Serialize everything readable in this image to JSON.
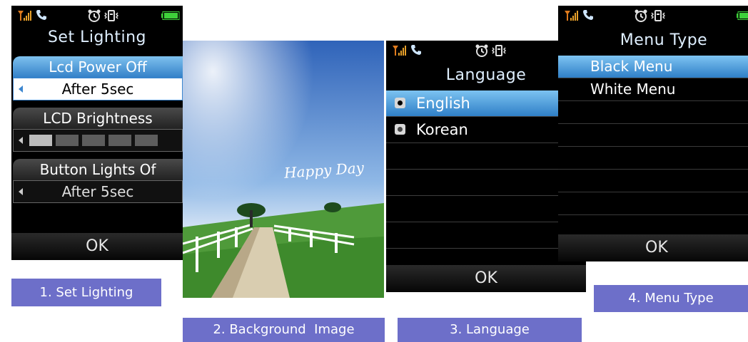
{
  "colors": {
    "caption_bg": "#6d6fc9",
    "highlight_blue": "#3380c8",
    "screen_bg": "#000000"
  },
  "screen1": {
    "title": "Set Lighting",
    "sections": [
      {
        "label": "Lcd Power Off",
        "value": "After 5sec"
      },
      {
        "label": "LCD Brightness",
        "level_filled": 1,
        "level_total": 5
      },
      {
        "label": "Button Lights Of",
        "value": "After 5sec"
      }
    ],
    "ok": "OK"
  },
  "screen2": {
    "overlay_text": "Happy Day"
  },
  "screen3": {
    "title": "Language",
    "options": [
      {
        "label": "English",
        "selected": true
      },
      {
        "label": "Korean",
        "selected": false
      }
    ],
    "ok": "OK"
  },
  "screen4": {
    "title": "Menu Type",
    "options": [
      {
        "label": "Black Menu",
        "selected": true
      },
      {
        "label": "White Menu",
        "selected": false
      }
    ],
    "ok": "OK"
  },
  "captions": [
    "1. Set Lighting",
    "2. Background  Image",
    "3. Language",
    "4. Menu Type"
  ]
}
